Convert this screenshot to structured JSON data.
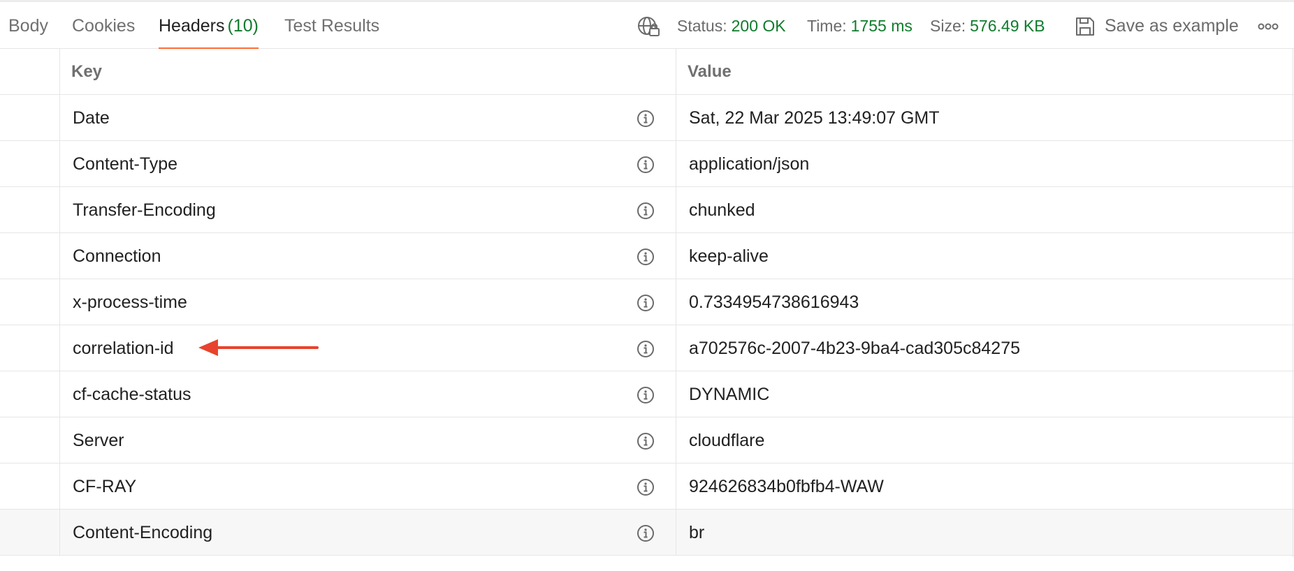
{
  "tabs": [
    {
      "label": "Body"
    },
    {
      "label": "Cookies"
    },
    {
      "label": "Headers",
      "count": "(10)"
    },
    {
      "label": "Test Results"
    }
  ],
  "status": {
    "icon": "globe-lock-icon",
    "status_label": "Status:",
    "status_value": "200 OK",
    "time_label": "Time:",
    "time_value": "1755 ms",
    "size_label": "Size:",
    "size_value": "576.49 KB"
  },
  "actions": {
    "save_label": "Save as example",
    "save_icon": "floppy-disk-icon",
    "more_icon": "more-options-icon"
  },
  "table": {
    "headers": {
      "key": "Key",
      "value": "Value"
    },
    "rows": [
      {
        "key": "Date",
        "value": "Sat, 22 Mar 2025 13:49:07 GMT"
      },
      {
        "key": "Content-Type",
        "value": "application/json"
      },
      {
        "key": "Transfer-Encoding",
        "value": "chunked"
      },
      {
        "key": "Connection",
        "value": "keep-alive"
      },
      {
        "key": "x-process-time",
        "value": "0.7334954738616943"
      },
      {
        "key": "correlation-id",
        "value": "a702576c-2007-4b23-9ba4-cad305c84275"
      },
      {
        "key": "cf-cache-status",
        "value": "DYNAMIC"
      },
      {
        "key": "Server",
        "value": "cloudflare"
      },
      {
        "key": "CF-RAY",
        "value": "924626834b0fbfb4-WAW"
      },
      {
        "key": "Content-Encoding",
        "value": "br"
      }
    ]
  },
  "colors": {
    "accent_tab_underline": "#ff6c37",
    "success_green": "#0f7b2c",
    "annotation_arrow": "#e8432e"
  }
}
